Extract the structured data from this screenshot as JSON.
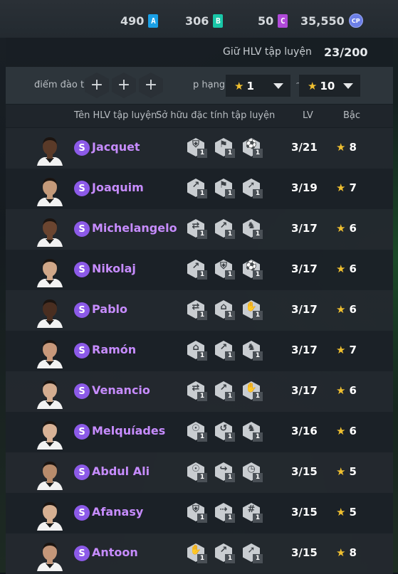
{
  "currencies": [
    {
      "value": "490",
      "icon": "A",
      "color": "#1aa0e6"
    },
    {
      "value": "306",
      "icon": "B",
      "color": "#19c7a8"
    },
    {
      "value": "50",
      "icon": "C",
      "color": "#b04ad9"
    },
    {
      "value": "35,550",
      "icon": "CP",
      "color": "#6c7fe6"
    }
  ],
  "hold": {
    "label": "Giữ HLV tập luyện",
    "count": "23/200"
  },
  "filter": {
    "points_label": "điểm đào tạ",
    "add_symbol": "+",
    "rank_label": "p hạng",
    "min": "1",
    "max": "10",
    "tilde": "~",
    "star": "★"
  },
  "columns": {
    "name": "Tên HLV tập luyện",
    "traits": "Sở hữu đặc tính tập luyện",
    "lv": "LV",
    "rank": "Bậc"
  },
  "badge_letter": "S",
  "trait_level": "1",
  "coaches": [
    {
      "name": "Jacquet",
      "lv": "3/21",
      "rank": "8",
      "skin": "#5a3a28",
      "traits": [
        "trait-shield-icon",
        "trait-run-icon",
        "trait-ball-icon"
      ]
    },
    {
      "name": "Joaquim",
      "lv": "3/19",
      "rank": "7",
      "skin": "#c49a7a",
      "traits": [
        "trait-kick-icon",
        "trait-run-icon",
        "trait-shoot-icon"
      ]
    },
    {
      "name": "Michelangelo",
      "lv": "3/17",
      "rank": "6",
      "skin": "#6b4530",
      "traits": [
        "trait-arrows-icon",
        "trait-kick-icon",
        "trait-boot-icon"
      ]
    },
    {
      "name": "Nikolaj",
      "lv": "3/17",
      "rank": "6",
      "skin": "#d0a788",
      "traits": [
        "trait-kick-icon",
        "trait-shield-icon",
        "trait-ball-icon"
      ]
    },
    {
      "name": "Pablo",
      "lv": "3/17",
      "rank": "6",
      "skin": "#4a2e20",
      "traits": [
        "trait-arrows-icon",
        "trait-goal-icon",
        "trait-keeper-icon"
      ]
    },
    {
      "name": "Ramón",
      "lv": "3/17",
      "rank": "7",
      "skin": "#c8987a",
      "traits": [
        "trait-goal-icon",
        "trait-kick-icon",
        "trait-boot-icon"
      ]
    },
    {
      "name": "Venancio",
      "lv": "3/17",
      "rank": "6",
      "skin": "#d4ad90",
      "traits": [
        "trait-arrows-icon",
        "trait-kick-icon",
        "trait-keeper-icon"
      ]
    },
    {
      "name": "Melquíades",
      "lv": "3/16",
      "rank": "6",
      "skin": "#d8b296",
      "traits": [
        "trait-head-icon",
        "trait-spin-icon",
        "trait-boot-icon"
      ]
    },
    {
      "name": "Abdul Ali",
      "lv": "3/15",
      "rank": "5",
      "skin": "#b88c6c",
      "traits": [
        "trait-head-icon",
        "trait-curve-icon",
        "trait-timer-icon"
      ]
    },
    {
      "name": "Afanasy",
      "lv": "3/15",
      "rank": "5",
      "skin": "#d6b092",
      "traits": [
        "trait-shield-icon",
        "trait-pass-icon",
        "trait-net-icon"
      ]
    },
    {
      "name": "Antoon",
      "lv": "3/15",
      "rank": "8",
      "skin": "#c4977a",
      "traits": [
        "trait-keeper-icon",
        "trait-kick-icon",
        "trait-shoot-icon"
      ]
    }
  ]
}
